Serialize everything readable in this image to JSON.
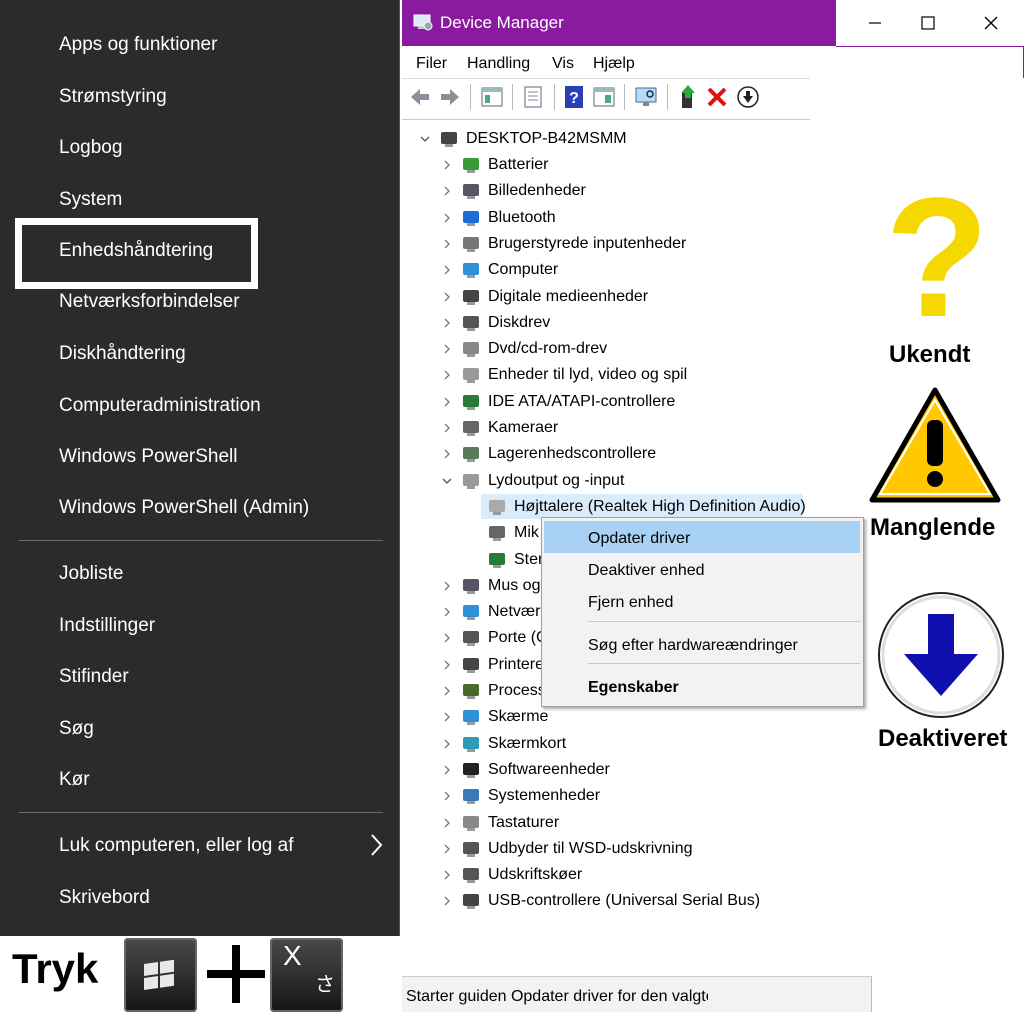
{
  "winx_menu": {
    "items": [
      {
        "label": "Apps og funktioner"
      },
      {
        "label": "Strømstyring"
      },
      {
        "label": "Logbog"
      },
      {
        "label": "System"
      },
      {
        "label": "Enhedshåndtering"
      },
      {
        "label": "Netværksforbindelser"
      },
      {
        "label": "Diskhåndtering"
      },
      {
        "label": "Computeradministration"
      },
      {
        "label": "Windows PowerShell"
      },
      {
        "label": "Windows PowerShell (Admin)"
      },
      {
        "label": "Jobliste"
      },
      {
        "label": "Indstillinger"
      },
      {
        "label": "Stifinder"
      },
      {
        "label": "Søg"
      },
      {
        "label": "Kør"
      },
      {
        "label": "Luk computeren, eller log af"
      },
      {
        "label": "Skrivebord"
      }
    ],
    "highlighted": "Enhedshåndtering"
  },
  "caption": {
    "tryk": "Tryk",
    "key_x": "X",
    "key_x_sub": "さ"
  },
  "device_manager": {
    "title": "Device Manager",
    "menus": [
      "Filer",
      "Handling",
      "Vis",
      "Hjælp"
    ],
    "tree": {
      "root": "DESKTOP-B42MSMM",
      "nodes": [
        "Batterier",
        "Billedenheder",
        "Bluetooth",
        "Brugerstyrede inputenheder",
        "Computer",
        "Digitale medieenheder",
        "Diskdrev",
        "Dvd/cd-rom-drev",
        "Enheder til lyd, video og spil",
        "IDE ATA/ATAPI-controllere",
        "Kameraer",
        "Lagerenhedscontrollere",
        "Lydoutput og -input",
        "Højttalere (Realtek High Definition Audio)",
        "Mik",
        "Ster",
        "Mus og",
        "Netvær",
        "Porte (C",
        "Printere",
        "Process",
        "Skærme",
        "Skærmkort",
        "Softwareenheder",
        "Systemenheder",
        "Tastaturer",
        "Udbyder til WSD-udskrivning",
        "Udskriftskøer",
        "USB-controllere (Universal Serial Bus)"
      ]
    },
    "status": "Starter guiden Opdater driver for den valgte"
  },
  "context_menu": {
    "items": [
      "Opdater driver",
      "Deaktiver enhed",
      "Fjern enhed",
      "Søg efter hardwareændringer",
      "Egenskaber"
    ],
    "highlighted": "Opdater driver"
  },
  "legend": {
    "unknown": "Ukendt",
    "missing": "Manglende",
    "disabled": "Deaktiveret"
  },
  "colors": {
    "titlebar": "#8a1aa0",
    "menu_bg": "#2b2b2b",
    "question_yellow": "#f5d800",
    "warning_yellow": "#ffc800",
    "arrow_blue": "#1010b0"
  }
}
